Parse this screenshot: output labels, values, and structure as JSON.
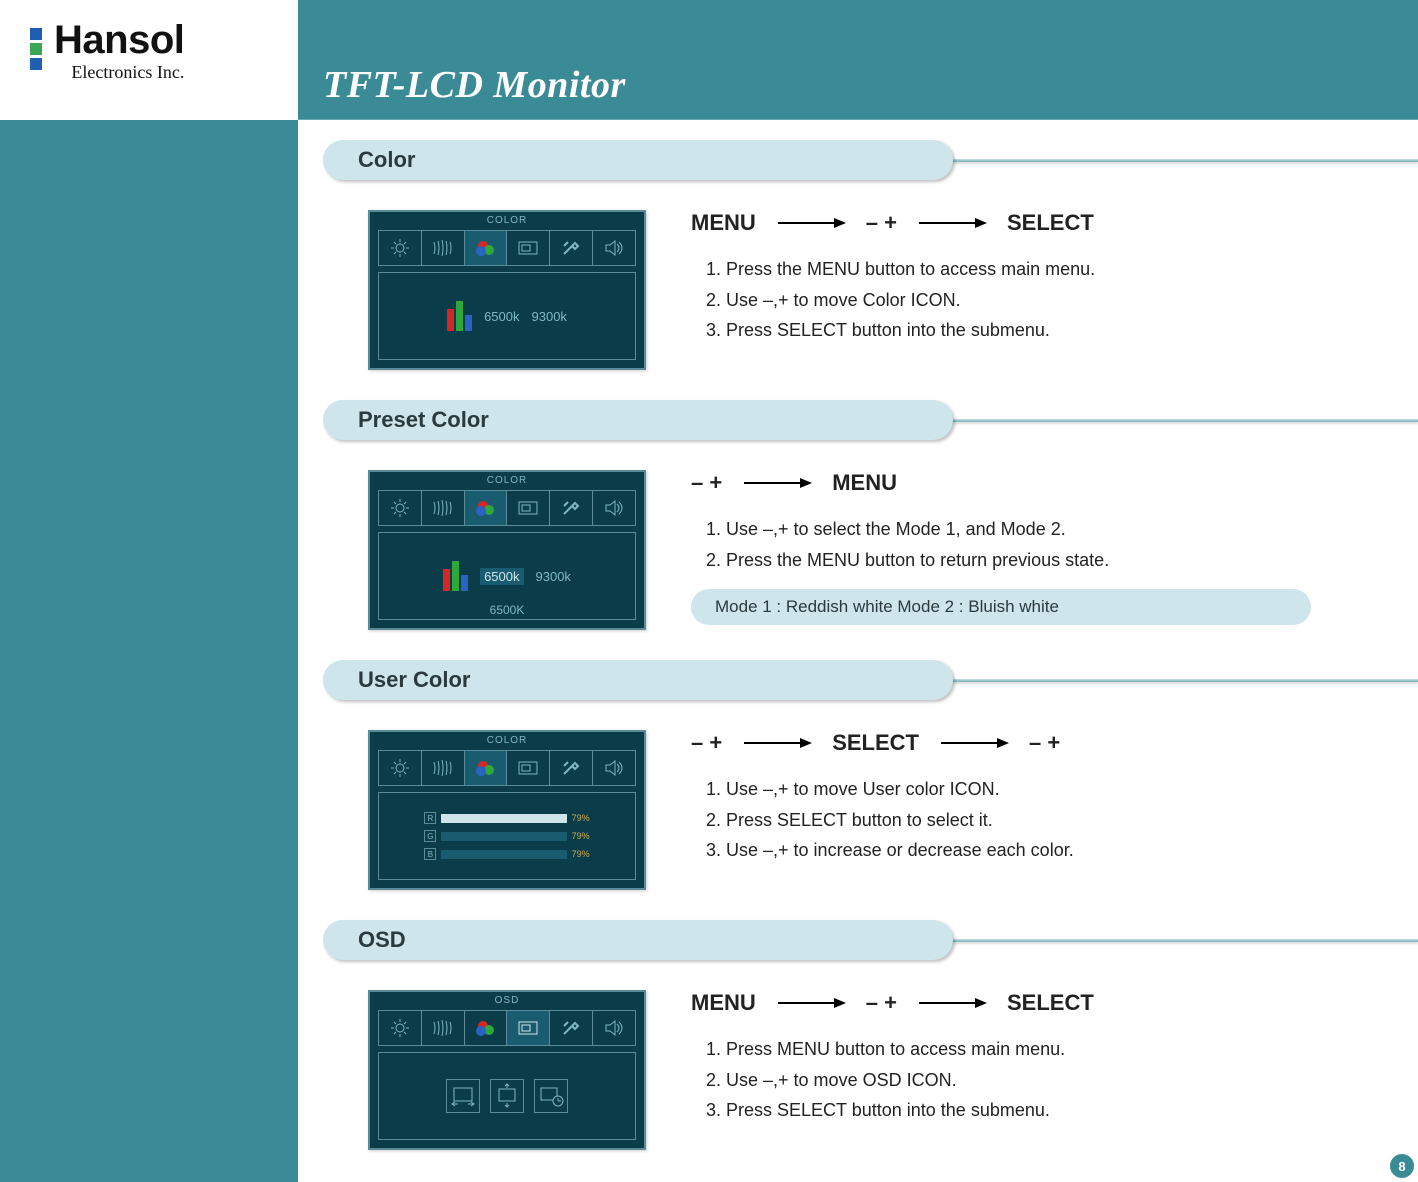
{
  "brand": {
    "name": "Hansol",
    "sub": "Electronics Inc."
  },
  "page_title": "TFT-LCD Monitor",
  "page_number": "8",
  "nav_labels": {
    "menu": "MENU",
    "plusminus": "–  +",
    "select": "SELECT"
  },
  "sections": {
    "color": {
      "heading": "Color",
      "osd_title": "COLOR",
      "temp1": "6500k",
      "temp2": "9300k",
      "steps": [
        "1. Press the MENU button to access main menu.",
        "2. Use –,+ to move Color ICON.",
        "3. Press SELECT button into the submenu."
      ]
    },
    "preset": {
      "heading": "Preset Color",
      "osd_title": "COLOR",
      "temp1": "6500k",
      "temp2": "9300k",
      "sub_label": "6500K",
      "steps": [
        "1. Use –,+ to select the Mode 1, and Mode 2.",
        "2. Press the MENU button to return previous state."
      ],
      "note": "Mode 1 : Reddish white      Mode 2 : Bluish white"
    },
    "user": {
      "heading": "User Color",
      "osd_title": "COLOR",
      "pct": "79%",
      "steps": [
        "1. Use –,+ to move User color ICON.",
        "2. Press SELECT button to select it.",
        "3. Use –,+ to increase or decrease each color."
      ]
    },
    "osd": {
      "heading": "OSD",
      "osd_title": "OSD",
      "steps": [
        "1. Press MENU button to access main menu.",
        "2. Use –,+ to move OSD ICON.",
        "3. Press SELECT button into the submenu."
      ]
    }
  }
}
